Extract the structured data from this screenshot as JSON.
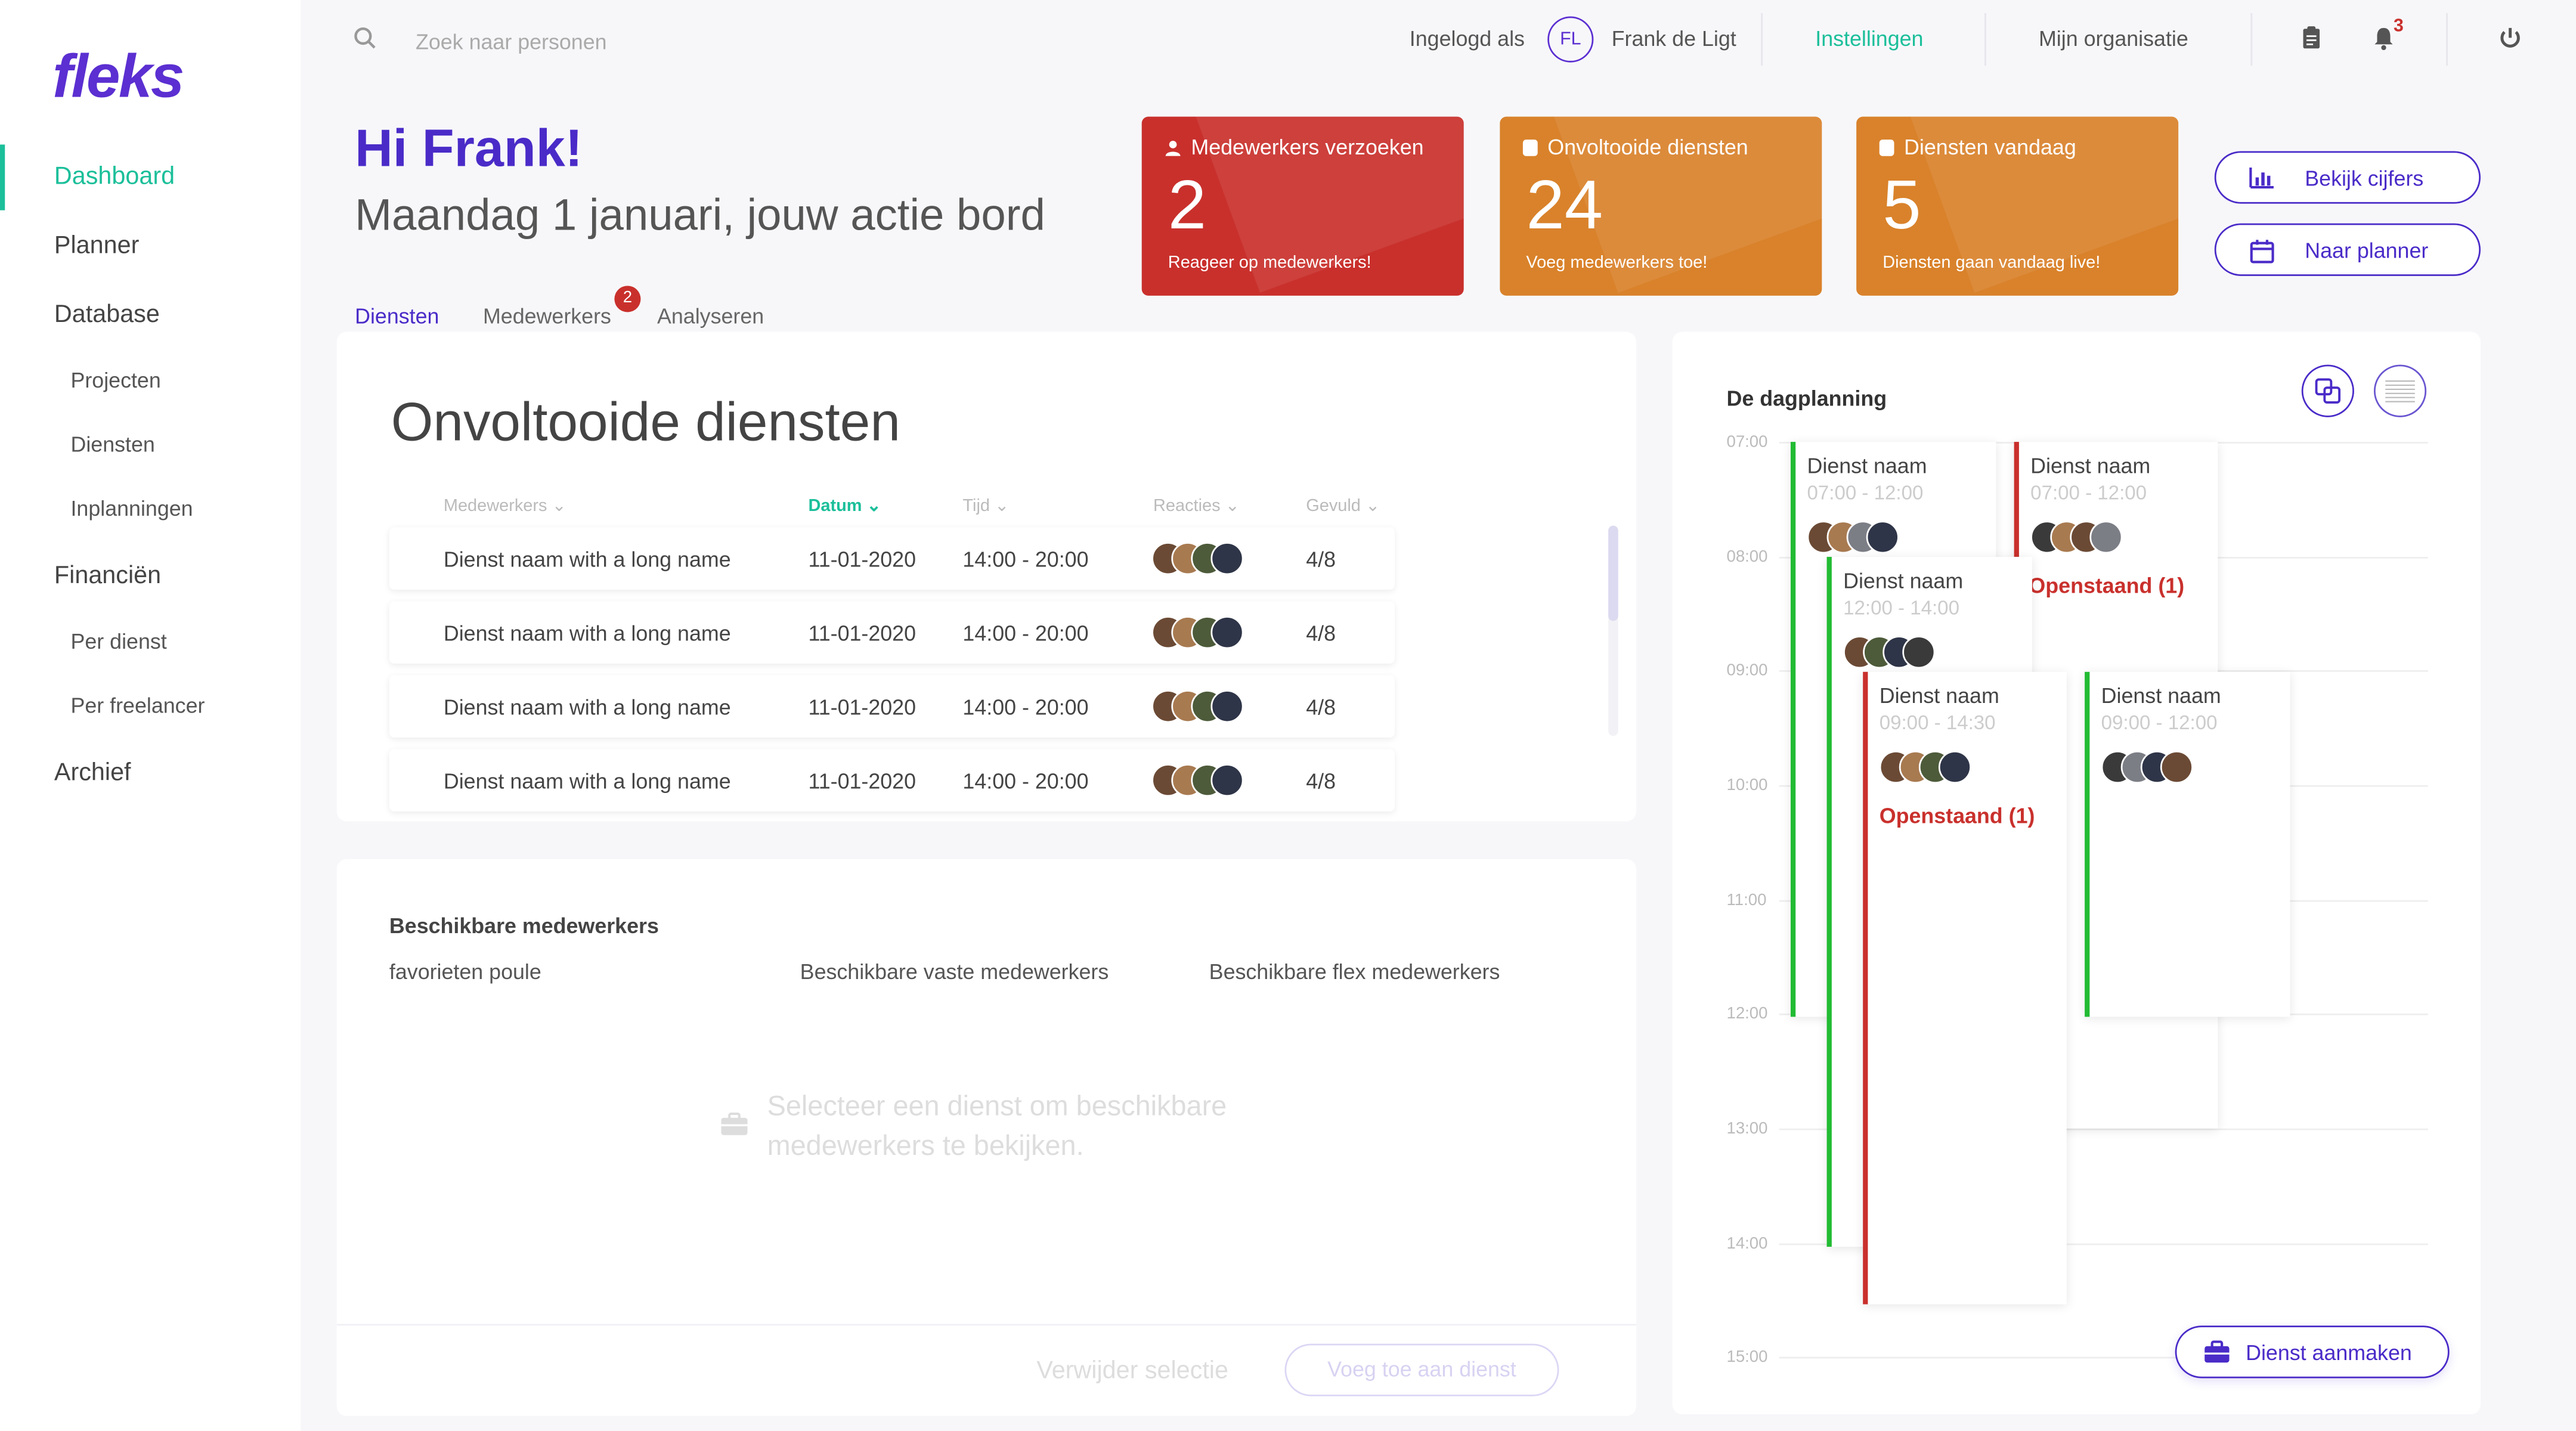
{
  "brand": {
    "logo_text": "fleks",
    "accent": "#4a2bc8",
    "green": "#1bbf9a",
    "red": "#c9302c",
    "orange": "#d9822b"
  },
  "sidebar": {
    "items": [
      {
        "label": "Dashboard",
        "active": true
      },
      {
        "label": "Planner"
      },
      {
        "label": "Database"
      },
      {
        "label": "Projecten",
        "sub": true
      },
      {
        "label": "Diensten",
        "sub": true
      },
      {
        "label": "Inplanningen",
        "sub": true
      },
      {
        "label": "Financiën"
      },
      {
        "label": "Per dienst",
        "sub": true
      },
      {
        "label": "Per freelancer",
        "sub": true
      },
      {
        "label": "Archief"
      }
    ]
  },
  "topbar": {
    "search_placeholder": "Zoek naar personen",
    "logged_in_label": "Ingelogd als",
    "user_initials": "FL",
    "user_name": "Frank de Ligt",
    "settings": "Instellingen",
    "organisation": "Mijn organisatie",
    "notification_count": "3"
  },
  "header": {
    "greeting": "Hi Frank!",
    "subtitle": "Maandag 1 januari, jouw actie bord"
  },
  "stats": [
    {
      "title": "Medewerkers verzoeken",
      "number": "2",
      "sub": "Reageer op medewerkers!",
      "color": "#c9302c"
    },
    {
      "title": "Onvoltooide diensten",
      "number": "24",
      "sub": "Voeg medewerkers toe!",
      "color": "#d9822b"
    },
    {
      "title": "Diensten vandaag",
      "number": "5",
      "sub": "Diensten gaan vandaag live!",
      "color": "#d9822b"
    }
  ],
  "actions": {
    "view_figures": "Bekijk cijfers",
    "to_planner": "Naar planner"
  },
  "tabs": [
    {
      "label": "Diensten",
      "active": true
    },
    {
      "label": "Medewerkers",
      "badge": "2"
    },
    {
      "label": "Analyseren"
    }
  ],
  "incomplete": {
    "title": "Onvoltooide diensten",
    "columns": [
      "Medewerkers",
      "Datum",
      "Tijd",
      "Reacties",
      "Gevuld"
    ],
    "rows": [
      {
        "name": "Dienst naam with a long name",
        "date": "11-01-2020",
        "time": "14:00 - 20:00",
        "filled": "4/8"
      },
      {
        "name": "Dienst naam with a long name",
        "date": "11-01-2020",
        "time": "14:00 - 20:00",
        "filled": "4/8"
      },
      {
        "name": "Dienst naam with a long name",
        "date": "11-01-2020",
        "time": "14:00 - 20:00",
        "filled": "4/8"
      },
      {
        "name": "Dienst naam with a long name",
        "date": "11-01-2020",
        "time": "14:00 - 20:00",
        "filled": "4/8"
      }
    ]
  },
  "available": {
    "title": "Beschikbare medewerkers",
    "cols": [
      "favorieten poule",
      "Beschikbare vaste medewerkers",
      "Beschikbare flex medewerkers"
    ],
    "empty_line1": "Selecteer een dienst om beschikbare",
    "empty_line2": "medewerkers te bekijken.",
    "remove_selection": "Verwijder selectie",
    "add_to_shift": "Voeg toe aan dienst"
  },
  "schedule": {
    "title": "De dagplanning",
    "hours": [
      "07:00",
      "08:00",
      "09:00",
      "10:00",
      "11:00",
      "12:00",
      "13:00",
      "14:00",
      "15:00"
    ],
    "shifts": [
      {
        "name": "Dienst naam",
        "time": "07:00 - 12:00",
        "status": "green"
      },
      {
        "name": "Dienst naam",
        "time": "07:00 - 12:00",
        "status": "red",
        "open": "Openstaand (1)"
      },
      {
        "name": "Dienst naam",
        "time": "12:00 - 14:00",
        "status": "green"
      },
      {
        "name": "Dienst naam",
        "time": "09:00 - 14:30",
        "status": "red",
        "open": "Openstaand (1)"
      },
      {
        "name": "Dienst naam",
        "time": "09:00 - 12:00",
        "status": "green"
      }
    ],
    "create_button": "Dienst aanmaken"
  }
}
